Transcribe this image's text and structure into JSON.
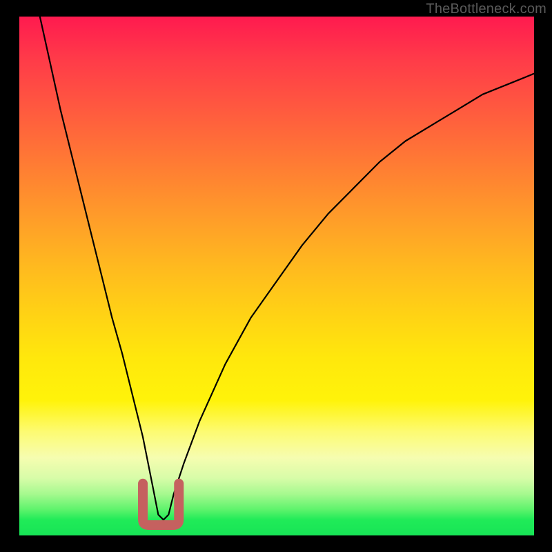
{
  "watermark": "TheBottleneck.com",
  "colors": {
    "curve": "#000000",
    "marker": "#c5615f",
    "background_frame": "#000000"
  },
  "chart_data": {
    "type": "line",
    "title": "",
    "xlabel": "",
    "ylabel": "",
    "xlim": [
      0,
      100
    ],
    "ylim": [
      0,
      100
    ],
    "grid": false,
    "legend": false,
    "note": "Axis labels and tick values are not shown in the source image; x/y are normalized 0–100. Curve descends from top-left to a minimum near x≈27 then rises toward upper-right.",
    "series": [
      {
        "name": "bottleneck-curve",
        "x": [
          4,
          6,
          8,
          10,
          12,
          14,
          16,
          18,
          20,
          22,
          24,
          25,
          26,
          27,
          28,
          29,
          30,
          32,
          35,
          40,
          45,
          50,
          55,
          60,
          65,
          70,
          75,
          80,
          85,
          90,
          95,
          100
        ],
        "values": [
          100,
          91,
          82,
          74,
          66,
          58,
          50,
          42,
          35,
          27,
          19,
          14,
          9,
          4,
          3,
          4,
          8,
          14,
          22,
          33,
          42,
          49,
          56,
          62,
          67,
          72,
          76,
          79,
          82,
          85,
          87,
          89
        ]
      }
    ],
    "marker": {
      "name": "highlight-near-minimum",
      "shape": "u",
      "x_range": [
        24,
        31
      ],
      "y_range": [
        2,
        10
      ],
      "color": "#c5615f",
      "stroke_width_px": 14
    }
  }
}
